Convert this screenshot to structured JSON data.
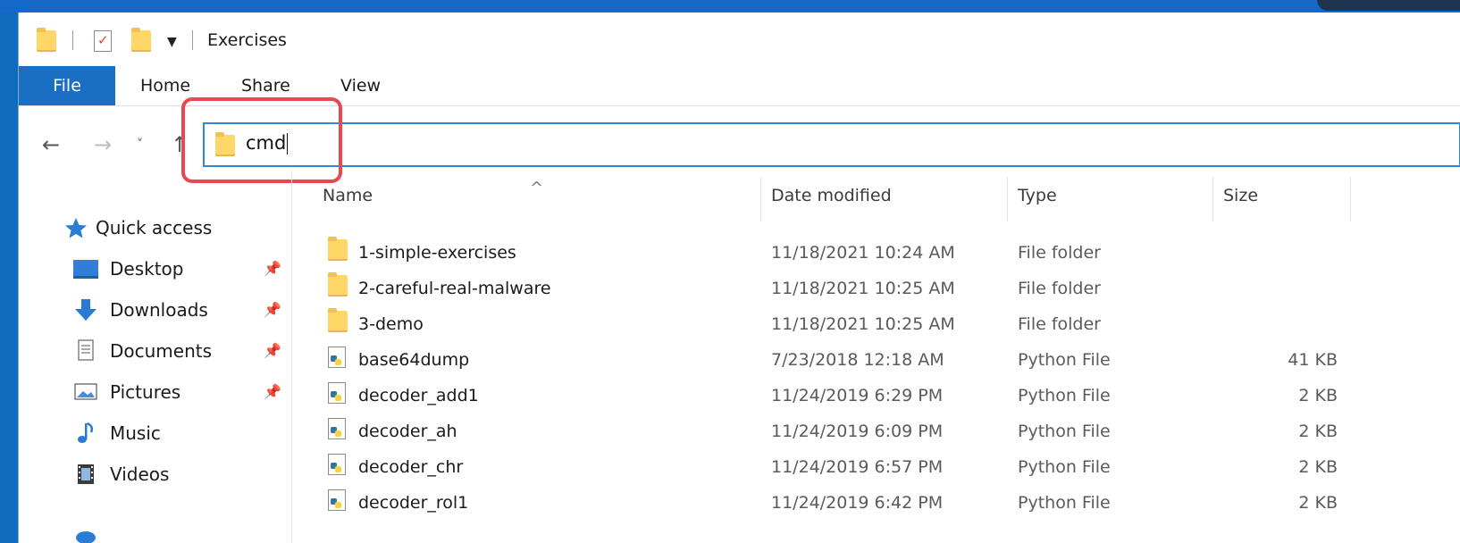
{
  "window": {
    "title": "Exercises"
  },
  "ribbon": {
    "tabs": [
      "File",
      "Home",
      "Share",
      "View"
    ]
  },
  "address": {
    "value": "cmd"
  },
  "sidebar": {
    "quick_access_label": "Quick access",
    "items": [
      {
        "label": "Desktop",
        "icon": "desktop-icon",
        "pinned": true
      },
      {
        "label": "Downloads",
        "icon": "downloads-icon",
        "pinned": true
      },
      {
        "label": "Documents",
        "icon": "documents-icon",
        "pinned": true
      },
      {
        "label": "Pictures",
        "icon": "pictures-icon",
        "pinned": true
      },
      {
        "label": "Music",
        "icon": "music-icon",
        "pinned": false
      },
      {
        "label": "Videos",
        "icon": "videos-icon",
        "pinned": false
      }
    ]
  },
  "columns": {
    "name": "Name",
    "date": "Date modified",
    "type": "Type",
    "size": "Size"
  },
  "files": [
    {
      "name": "1-simple-exercises",
      "date": "11/18/2021 10:24 AM",
      "type": "File folder",
      "size": "",
      "icon": "folder-icon"
    },
    {
      "name": "2-careful-real-malware",
      "date": "11/18/2021 10:25 AM",
      "type": "File folder",
      "size": "",
      "icon": "folder-icon"
    },
    {
      "name": "3-demo",
      "date": "11/18/2021 10:25 AM",
      "type": "File folder",
      "size": "",
      "icon": "folder-icon"
    },
    {
      "name": "base64dump",
      "date": "7/23/2018 12:18 AM",
      "type": "Python File",
      "size": "41 KB",
      "icon": "python-file-icon"
    },
    {
      "name": "decoder_add1",
      "date": "11/24/2019 6:29 PM",
      "type": "Python File",
      "size": "2 KB",
      "icon": "python-file-icon"
    },
    {
      "name": "decoder_ah",
      "date": "11/24/2019 6:09 PM",
      "type": "Python File",
      "size": "2 KB",
      "icon": "python-file-icon"
    },
    {
      "name": "decoder_chr",
      "date": "11/24/2019 6:57 PM",
      "type": "Python File",
      "size": "2 KB",
      "icon": "python-file-icon"
    },
    {
      "name": "decoder_rol1",
      "date": "11/24/2019 6:42 PM",
      "type": "Python File",
      "size": "2 KB",
      "icon": "python-file-icon"
    }
  ],
  "colors": {
    "accent": "#1a6fc4",
    "highlight": "#e8484f",
    "folder": "#ffd768"
  }
}
